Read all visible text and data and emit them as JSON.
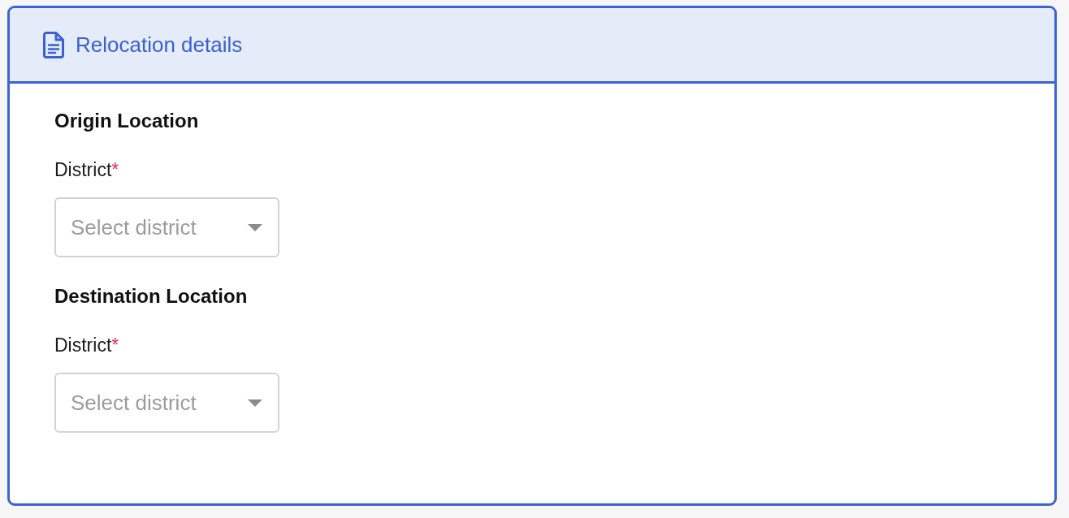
{
  "panel": {
    "title": "Relocation details"
  },
  "sections": [
    {
      "heading": "Origin Location",
      "fields": [
        {
          "label": "District",
          "required_mark": "*",
          "placeholder": "Select district"
        }
      ]
    },
    {
      "heading": "Destination Location",
      "fields": [
        {
          "label": "District",
          "required_mark": "*",
          "placeholder": "Select district"
        }
      ]
    }
  ]
}
